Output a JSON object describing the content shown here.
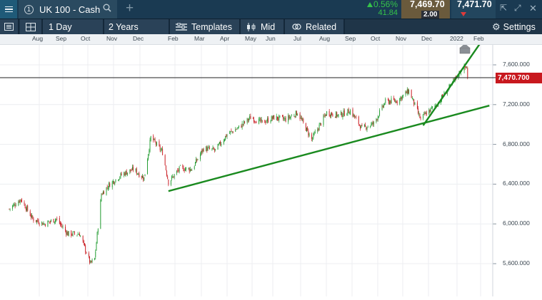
{
  "header": {
    "instrument_number": "1",
    "instrument_title": "UK 100 - Cash",
    "change_percent": "0.56%",
    "change_abs": "41.84",
    "sell_price": "7,469.70",
    "buy_price": "7,471.70",
    "spread": "2.00"
  },
  "toolbar": {
    "interval": "1 Day",
    "range": "2 Years",
    "templates": "Templates",
    "price_type": "Mid",
    "related": "Related",
    "settings": "Settings"
  },
  "time_axis": [
    "Aug",
    "Sep",
    "Oct",
    "Nov",
    "Dec",
    "Feb",
    "Mar",
    "Apr",
    "May",
    "Jun",
    "Jul",
    "Aug",
    "Sep",
    "Oct",
    "Nov",
    "Dec",
    "2022",
    "Feb"
  ],
  "price_axis": [
    "7,600.000",
    "7,200.000",
    "6,800.000",
    "6,400.000",
    "6,000.000",
    "5,600.000"
  ],
  "current_price_label": "7,470.700",
  "colors": {
    "bull": "#1f9b2e",
    "bear": "#c8181e",
    "trendline": "#1a8a1f",
    "flag": "#c8181e"
  },
  "chart_data": {
    "type": "candlestick",
    "series_anchors": [
      {
        "date": "2020-07-23",
        "close": 6150
      },
      {
        "date": "2020-08-06",
        "close": 6250
      },
      {
        "date": "2020-08-20",
        "close": 6050
      },
      {
        "date": "2020-09-03",
        "close": 6000
      },
      {
        "date": "2020-09-17",
        "close": 6050
      },
      {
        "date": "2020-10-01",
        "close": 5900
      },
      {
        "date": "2020-10-15",
        "close": 5900
      },
      {
        "date": "2020-10-28",
        "close": 5600
      },
      {
        "date": "2020-11-02",
        "close": 5650
      },
      {
        "date": "2020-11-10",
        "close": 6300
      },
      {
        "date": "2020-11-20",
        "close": 6400
      },
      {
        "date": "2020-12-05",
        "close": 6500
      },
      {
        "date": "2020-12-18",
        "close": 6550
      },
      {
        "date": "2020-12-31",
        "close": 6460
      },
      {
        "date": "2021-01-08",
        "close": 6870
      },
      {
        "date": "2021-01-22",
        "close": 6720
      },
      {
        "date": "2021-01-29",
        "close": 6420
      },
      {
        "date": "2021-02-12",
        "close": 6560
      },
      {
        "date": "2021-02-26",
        "close": 6550
      },
      {
        "date": "2021-03-12",
        "close": 6760
      },
      {
        "date": "2021-03-26",
        "close": 6740
      },
      {
        "date": "2021-04-09",
        "close": 6900
      },
      {
        "date": "2021-04-23",
        "close": 6970
      },
      {
        "date": "2021-05-07",
        "close": 7070
      },
      {
        "date": "2021-05-21",
        "close": 7020
      },
      {
        "date": "2021-06-04",
        "close": 7070
      },
      {
        "date": "2021-06-18",
        "close": 7050
      },
      {
        "date": "2021-07-02",
        "close": 7120
      },
      {
        "date": "2021-07-19",
        "close": 6850
      },
      {
        "date": "2021-08-06",
        "close": 7120
      },
      {
        "date": "2021-08-20",
        "close": 7090
      },
      {
        "date": "2021-09-03",
        "close": 7140
      },
      {
        "date": "2021-09-17",
        "close": 6960
      },
      {
        "date": "2021-10-01",
        "close": 7010
      },
      {
        "date": "2021-10-15",
        "close": 7230
      },
      {
        "date": "2021-10-29",
        "close": 7240
      },
      {
        "date": "2021-11-12",
        "close": 7340
      },
      {
        "date": "2021-11-26",
        "close": 7050
      },
      {
        "date": "2021-12-01",
        "close": 7100
      },
      {
        "date": "2021-12-15",
        "close": 7200
      },
      {
        "date": "2021-12-31",
        "close": 7380
      },
      {
        "date": "2022-01-14",
        "close": 7560
      },
      {
        "date": "2022-01-20",
        "close": 7580
      },
      {
        "date": "2022-01-21",
        "close": 7470
      }
    ],
    "trendlines": [
      {
        "from": {
          "date": "2021-01-29",
          "value": 6330
        },
        "to": {
          "date": "2022-02-16",
          "value": 7190
        }
      },
      {
        "from": {
          "date": "2021-11-29",
          "value": 6990
        },
        "to": {
          "date": "2022-02-16",
          "value": 7950
        }
      }
    ],
    "current_price": 7470.7,
    "ylim": [
      5450,
      7750
    ]
  }
}
